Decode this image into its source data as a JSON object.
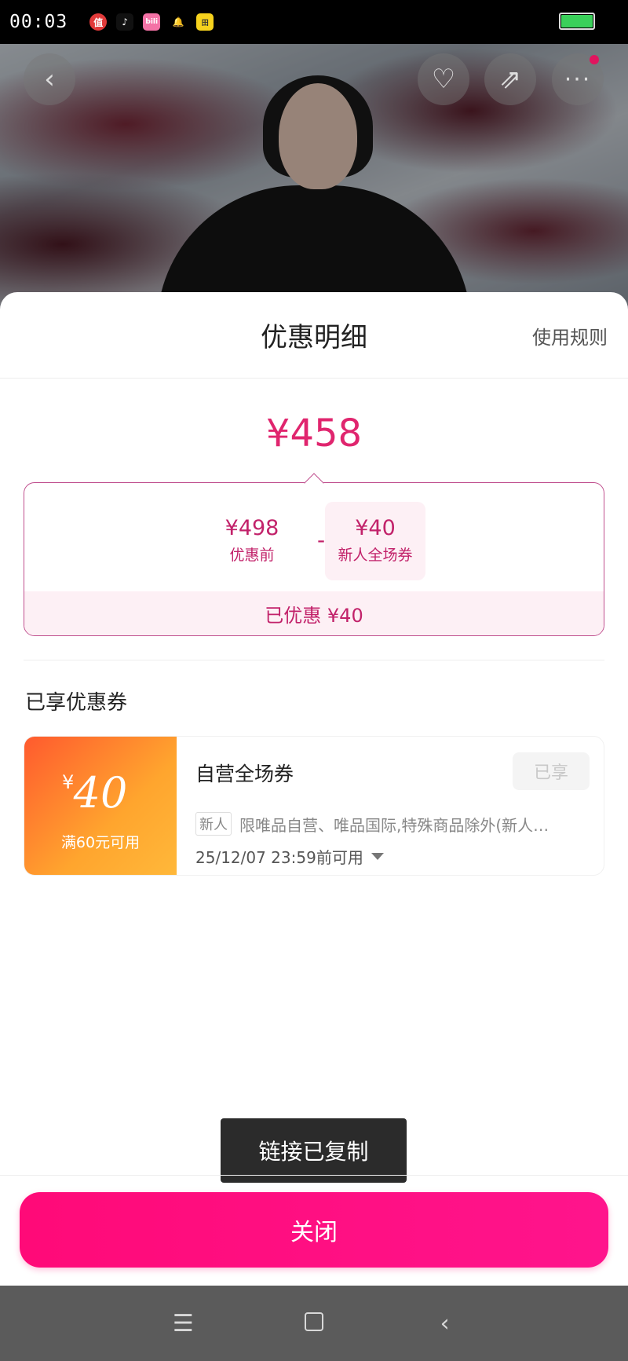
{
  "status_bar": {
    "time": "00:03",
    "apps": [
      {
        "icon": "zhi-app-icon",
        "glyph": "值"
      },
      {
        "icon": "tiktok-icon",
        "glyph": "♪"
      },
      {
        "icon": "bilibili-icon",
        "glyph": "bili"
      },
      {
        "icon": "qq-icon",
        "glyph": "🔔"
      },
      {
        "icon": "tiantian-icon",
        "glyph": "田"
      }
    ],
    "battery_level": 1.0,
    "battery_color": "#3ad05a"
  },
  "hero": {
    "back_glyph": "‹",
    "fav_glyph": "♡",
    "share_glyph": "⇗",
    "more_glyph": "···"
  },
  "sheet": {
    "title": "优惠明细",
    "rules_label": "使用规则",
    "total_price": "¥458",
    "breakdown": {
      "before_amount": "¥498",
      "before_label": "优惠前",
      "minus": "-",
      "coupon_amount": "¥40",
      "coupon_label": "新人全场券",
      "saved_text": "已优惠 ¥40"
    },
    "section_title": "已享优惠券",
    "coupon": {
      "currency": "¥",
      "amount": "40",
      "condition": "满60元可用",
      "name": "自营全场券",
      "status": "已享",
      "tag": "新人",
      "description": "限唯品自营、唯品国际,特殊商品除外(新人…",
      "expiry": "25/12/07 23:59前可用"
    }
  },
  "toast": "链接已复制",
  "close_label": "关闭",
  "nav": {
    "menu_glyph": "☰",
    "back_glyph": "‹"
  },
  "colors": {
    "accent": "#e0256e",
    "button": "#ff0a78",
    "coupon_gradient_start": "#ff5a2e",
    "coupon_gradient_end": "#ffb83a"
  }
}
